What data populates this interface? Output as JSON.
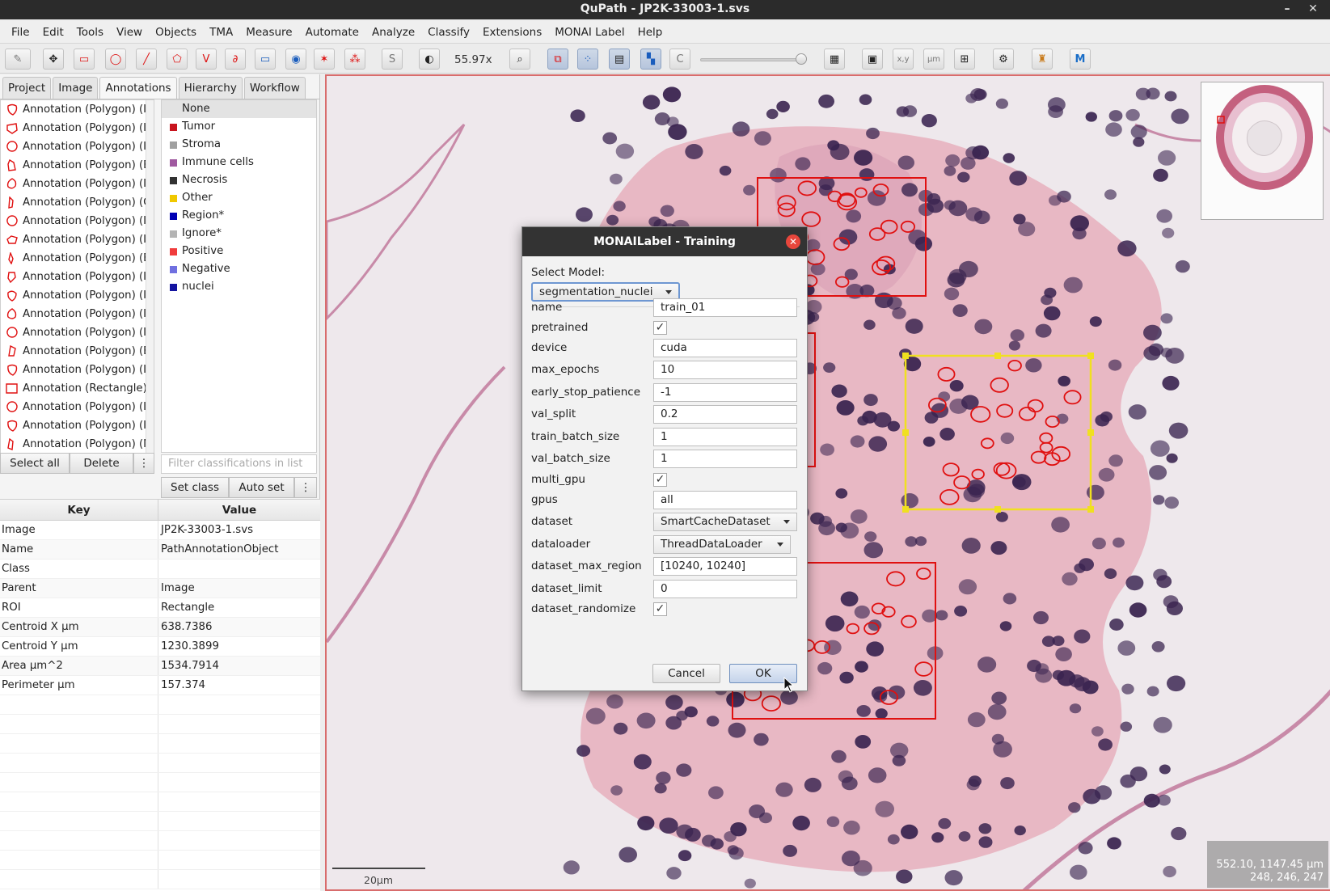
{
  "window": {
    "title": "QuPath - JP2K-33003-1.svs"
  },
  "menu": [
    "File",
    "Edit",
    "Tools",
    "View",
    "Objects",
    "TMA",
    "Measure",
    "Automate",
    "Analyze",
    "Classify",
    "Extensions",
    "MONAI Label",
    "Help"
  ],
  "toolbar": {
    "zoom": "55.97x",
    "zoom_slider_fraction": 0.93
  },
  "tabs": [
    "Project",
    "Image",
    "Annotations",
    "Hierarchy",
    "Workflow"
  ],
  "active_tab": "Annotations",
  "annotations": [
    "Annotation (Polygon) (I",
    "Annotation (Polygon) (I",
    "Annotation (Polygon) (I",
    "Annotation (Polygon) (E",
    "Annotation (Polygon) (I",
    "Annotation (Polygon) (Co",
    "Annotation (Polygon) (I",
    "Annotation (Polygon) (I",
    "Annotation (Polygon) (Ep",
    "Annotation (Polygon) (In",
    "Annotation (Polygon) (I",
    "Annotation (Polygon) (I",
    "Annotation (Polygon) (I",
    "Annotation (Polygon) (E",
    "Annotation (Polygon) (I",
    "Annotation (Rectangle)",
    "Annotation (Polygon) (I",
    "Annotation (Polygon) (I",
    "Annotation (Polygon) (Nu"
  ],
  "classes": [
    {
      "name": "None",
      "color": ""
    },
    {
      "name": "Tumor",
      "color": "#c8141e"
    },
    {
      "name": "Stroma",
      "color": "#a0a0a0"
    },
    {
      "name": "Immune cells",
      "color": "#a05aa0"
    },
    {
      "name": "Necrosis",
      "color": "#323232"
    },
    {
      "name": "Other",
      "color": "#f0c800"
    },
    {
      "name": "Region*",
      "color": "#0000b4"
    },
    {
      "name": "Ignore*",
      "color": "#b4b4b4"
    },
    {
      "name": "Positive",
      "color": "#f03c3c"
    },
    {
      "name": "Negative",
      "color": "#7070e0"
    },
    {
      "name": "nuclei",
      "color": "#1414a0"
    }
  ],
  "class_filter_placeholder": "Filter classifications in list",
  "annotation_buttons": {
    "select_all": "Select all",
    "delete": "Delete",
    "more": "⋮"
  },
  "class_buttons": {
    "set_class": "Set class",
    "auto_set": "Auto set",
    "more": "⋮"
  },
  "properties": {
    "headers": {
      "key": "Key",
      "value": "Value"
    },
    "rows": [
      {
        "key": "Image",
        "value": "JP2K-33003-1.svs"
      },
      {
        "key": "Name",
        "value": "PathAnnotationObject"
      },
      {
        "key": "Class",
        "value": ""
      },
      {
        "key": "Parent",
        "value": "Image"
      },
      {
        "key": "ROI",
        "value": "Rectangle"
      },
      {
        "key": "Centroid X µm",
        "value": "638.7386"
      },
      {
        "key": "Centroid Y µm",
        "value": "1230.3899"
      },
      {
        "key": "Area µm^2",
        "value": "1534.7914"
      },
      {
        "key": "Perimeter µm",
        "value": "157.374"
      }
    ]
  },
  "viewer": {
    "scale_label": "20µm",
    "coords_line1": "552.10, 1147.45 µm",
    "coords_line2": "248, 246, 247"
  },
  "dialog": {
    "title": "MONAILabel - Training",
    "select_model_label": "Select Model:",
    "model": "segmentation_nuclei",
    "fields": {
      "name": {
        "label": "name",
        "value": "train_01"
      },
      "pretrained": {
        "label": "pretrained",
        "checked": "✓"
      },
      "device": {
        "label": "device",
        "value": "cuda"
      },
      "max_epochs": {
        "label": "max_epochs",
        "value": "10"
      },
      "early_stop_patience": {
        "label": "early_stop_patience",
        "value": "-1"
      },
      "val_split": {
        "label": "val_split",
        "value": "0.2"
      },
      "train_batch_size": {
        "label": "train_batch_size",
        "value": "1"
      },
      "val_batch_size": {
        "label": "val_batch_size",
        "value": "1"
      },
      "multi_gpu": {
        "label": "multi_gpu",
        "checked": "✓"
      },
      "gpus": {
        "label": "gpus",
        "value": "all"
      },
      "dataset": {
        "label": "dataset",
        "value": "SmartCacheDataset"
      },
      "dataloader": {
        "label": "dataloader",
        "value": "ThreadDataLoader"
      },
      "dataset_max_region": {
        "label": "dataset_max_region",
        "value": "[10240, 10240]"
      },
      "dataset_limit": {
        "label": "dataset_limit",
        "value": "0"
      },
      "dataset_randomize": {
        "label": "dataset_randomize",
        "checked": "✓"
      }
    },
    "cancel_label": "Cancel",
    "ok_label": "OK"
  },
  "colors": {
    "annotation": "#e01010",
    "selected": "#f0e020",
    "tissue": "#e8b8c4",
    "nucleus": "#3a2450"
  }
}
